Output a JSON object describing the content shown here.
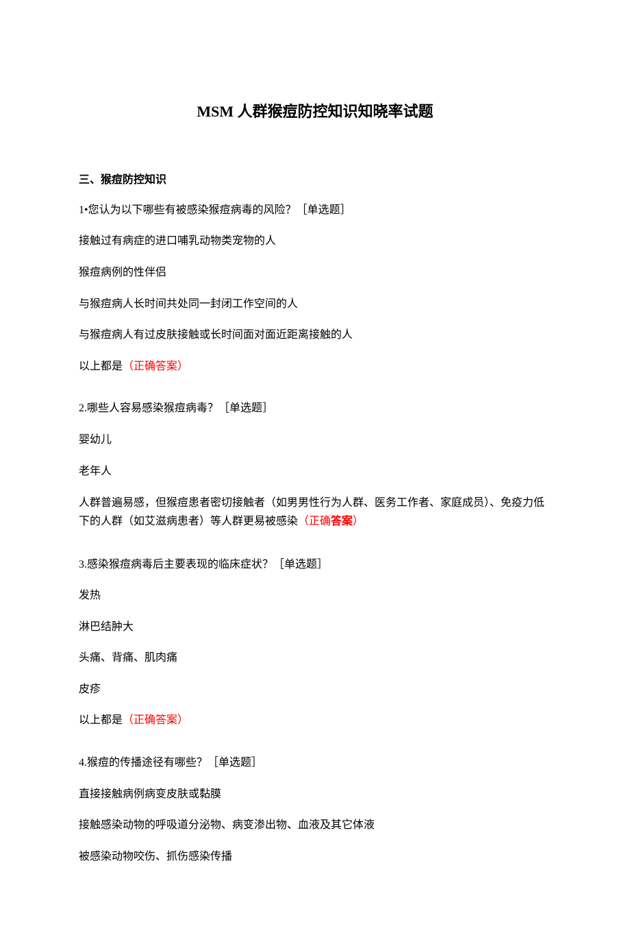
{
  "title": "MSM 人群猴痘防控知识知晓率试题",
  "section_header": "三、猴痘防控知识",
  "questions": [
    {
      "stem": "1•您认为以下哪些有被感染猴痘病毒的风险？［单选题］",
      "options": [
        {
          "text": "接触过有病症的进口哺乳动物类宠物的人",
          "correct": false
        },
        {
          "text": "猴痘病例的性伴侣",
          "correct": false
        },
        {
          "text": "与猴痘病人长时间共处同一封闭工作空间的人",
          "correct": false
        },
        {
          "text": "与猴痘病人有过皮肤接触或长时间面对面近距离接触的人",
          "correct": false
        },
        {
          "text": "以上都是",
          "correct": true,
          "answer_label": "（正确答案）"
        }
      ]
    },
    {
      "stem": "2.哪些人容易感染猴痘病毒？［单选题］",
      "options": [
        {
          "text": "婴幼儿",
          "correct": false
        },
        {
          "text": "老年人",
          "correct": false
        },
        {
          "text_prefix": "人群普遍易感，但猴痘患者密切接触者（如男男性行为人群、医务工作者、家庭成员）、免疫力低下的人群（如艾滋病患者）等人群更易被感染",
          "correct": true,
          "answer_prefix": "（正确",
          "answer_bold": "答案",
          "answer_suffix": "）",
          "multiline": true
        }
      ]
    },
    {
      "stem": "3.感染猴痘病毒后主要表现的临床症状？［单选题］",
      "options": [
        {
          "text": "发热",
          "correct": false
        },
        {
          "text": "淋巴结肿大",
          "correct": false
        },
        {
          "text": "头痛、背痛、肌肉痛",
          "correct": false
        },
        {
          "text": "皮疹",
          "correct": false
        },
        {
          "text": "以上都是",
          "correct": true,
          "answer_label": "（正确答案）"
        }
      ]
    },
    {
      "stem": "4.猴痘的传播途径有哪些？［单选题］",
      "options": [
        {
          "text": "直接接触病例病变皮肤或黏膜",
          "correct": false
        },
        {
          "text": "接触感染动物的呼吸道分泌物、病变渗出物、血液及其它体液",
          "correct": false
        },
        {
          "text": "被感染动物咬伤、抓伤感染传播",
          "correct": false
        }
      ]
    }
  ]
}
